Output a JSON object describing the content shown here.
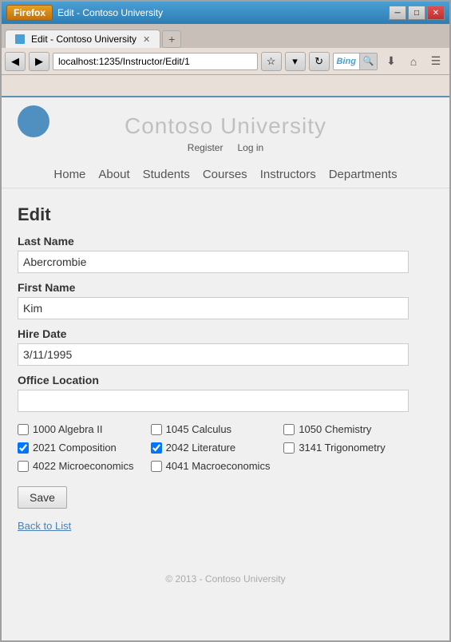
{
  "browser": {
    "firefox_label": "Firefox",
    "tab_title": "Edit - Contoso University",
    "url": "localhost:1235/Instructor/Edit/1",
    "search_placeholder": "Bing",
    "new_tab_symbol": "+",
    "nav_back": "◀",
    "nav_forward": "▶",
    "nav_refresh": "↻",
    "toolbar_download": "⬇",
    "toolbar_home": "⌂",
    "toolbar_bookmarks": "☆",
    "ctrl_minimize": "─",
    "ctrl_restore": "□",
    "ctrl_close": "✕"
  },
  "site": {
    "title": "Contoso University",
    "register_label": "Register",
    "login_label": "Log in",
    "footer": "© 2013 - Contoso University"
  },
  "nav": {
    "items": [
      {
        "label": "Home"
      },
      {
        "label": "About"
      },
      {
        "label": "Students"
      },
      {
        "label": "Courses"
      },
      {
        "label": "Instructors"
      },
      {
        "label": "Departments"
      }
    ]
  },
  "form": {
    "heading": "Edit",
    "last_name_label": "Last Name",
    "last_name_value": "Abercrombie",
    "first_name_label": "First Name",
    "first_name_value": "Kim",
    "hire_date_label": "Hire Date",
    "hire_date_value": "3/11/1995",
    "office_location_label": "Office Location",
    "office_location_value": "",
    "save_button": "Save",
    "back_link": "Back to List"
  },
  "courses": [
    {
      "id": "1000",
      "name": "Algebra II",
      "checked": false
    },
    {
      "id": "1045",
      "name": "Calculus",
      "checked": false
    },
    {
      "id": "1050",
      "name": "Chemistry",
      "checked": false
    },
    {
      "id": "2021",
      "name": "Composition",
      "checked": true
    },
    {
      "id": "2042",
      "name": "Literature",
      "checked": true
    },
    {
      "id": "3141",
      "name": "Trigonometry",
      "checked": false
    },
    {
      "id": "4022",
      "name": "Microeconomics",
      "checked": false
    },
    {
      "id": "4041",
      "name": "Macroeconomics",
      "checked": false
    }
  ]
}
